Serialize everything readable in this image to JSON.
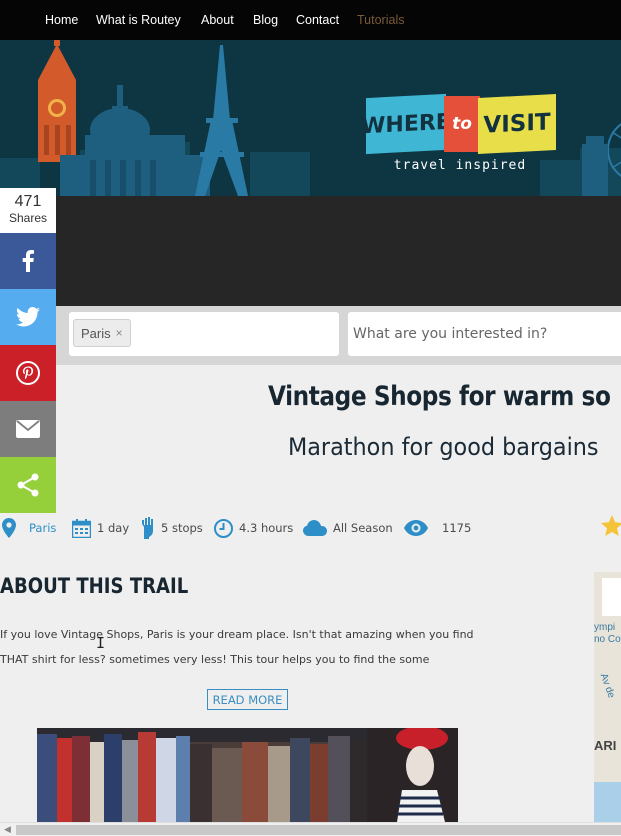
{
  "nav": {
    "items": [
      {
        "label": "Home"
      },
      {
        "label": "What is Routey"
      },
      {
        "label": "About"
      },
      {
        "label": "Blog"
      },
      {
        "label": "Contact"
      },
      {
        "label": "Tutorials"
      }
    ]
  },
  "logo": {
    "where": "WHERE",
    "to": "to",
    "visit": "VISIT",
    "tagline": "travel inspired"
  },
  "search": {
    "location_tag": "Paris",
    "tag_remove": "×",
    "interest_placeholder": "What are you interested in?"
  },
  "share": {
    "count": "471",
    "label": "Shares",
    "buttons": [
      {
        "icon": "facebook-icon",
        "color": "#3b5998"
      },
      {
        "icon": "twitter-icon",
        "color": "#55acee"
      },
      {
        "icon": "pinterest-icon",
        "color": "#cb2027"
      },
      {
        "icon": "email-icon",
        "color": "#7d7d7d"
      },
      {
        "icon": "share-icon",
        "color": "#95d03a"
      }
    ]
  },
  "trail": {
    "title": "Vintage Shops for warm so",
    "subtitle": "Marathon for good bargains",
    "meta": {
      "location": "Paris",
      "duration": "1 day",
      "stops": "5 stops",
      "hours": "4.3 hours",
      "season": "All Season",
      "views": "1175"
    },
    "about_heading": "ABOUT THIS TRAIL",
    "about_text": "If you love Vintage Shops, Paris is your dream place. Isn't that amazing when you find THAT shirt for less? sometimes very less! This tour helps you to find the some",
    "read_more": "READ MORE"
  },
  "map": {
    "labels": [
      "ympi",
      "no Co",
      "Av de",
      "ARI"
    ]
  },
  "colors": {
    "accent": "#2e8fc8",
    "banner": "#0d3542",
    "nav_bg": "#050505",
    "tutorials": "#7a5a38"
  }
}
